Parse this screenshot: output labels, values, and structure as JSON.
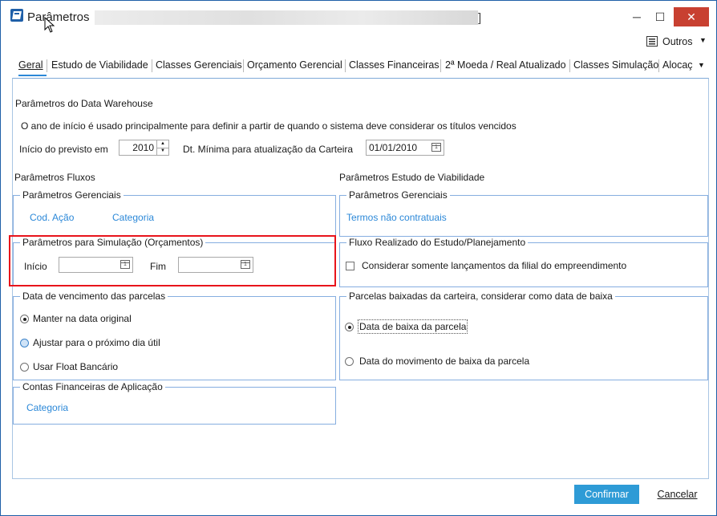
{
  "window": {
    "title": "Parâmetros",
    "title_suffix": "]",
    "minimize_glyph": "─",
    "maximize_glyph": "☐",
    "close_glyph": "✕"
  },
  "toolbar": {
    "outros_label": "Outros"
  },
  "tabs": [
    {
      "label": "Geral"
    },
    {
      "label": "Estudo de Viabilidade"
    },
    {
      "label": "Classes Gerenciais"
    },
    {
      "label": "Orçamento Gerencial"
    },
    {
      "label": "Classes Financeiras"
    },
    {
      "label": "2ª Moeda / Real Atualizado"
    },
    {
      "label": "Classes Simulação"
    },
    {
      "label": "Alocaç"
    }
  ],
  "dw": {
    "title": "Parâmetros do Data Warehouse",
    "desc": "O ano de início é usado principalmente para definir a partir de quando o sistema deve considerar os títulos vencidos",
    "inicio_label": "Início do previsto em",
    "inicio_value": "2010",
    "dt_label": "Dt. Mínima para atualização da Carteira",
    "dt_value": "01/01/2010"
  },
  "fluxos": {
    "title": "Parâmetros Fluxos",
    "gerenciais": {
      "title": "Parâmetros Gerenciais",
      "link1": "Cod. Ação",
      "link2": "Categoria"
    },
    "simulacao": {
      "title": "Parâmetros para Simulação (Orçamentos)",
      "inicio_label": "Início",
      "fim_label": "Fim"
    },
    "vencimento": {
      "title": "Data de vencimento das parcelas",
      "options": [
        "Manter na data original",
        "Ajustar para o próximo dia útil",
        "Usar Float Bancário"
      ]
    },
    "contas": {
      "title": "Contas Financeiras de Aplicação",
      "link": "Categoria"
    }
  },
  "viabilidade": {
    "title": "Parâmetros Estudo de Viabilidade",
    "gerenciais": {
      "title": "Parâmetros Gerenciais",
      "link": "Termos não contratuais"
    },
    "fluxo_realizado": {
      "title": "Fluxo Realizado do Estudo/Planejamento",
      "checkbox_label": "Considerar somente lançamentos da filial do empreendimento"
    },
    "baixadas": {
      "title": "Parcelas baixadas da carteira, considerar como data de baixa",
      "options": [
        "Data de baixa da parcela",
        "Data do movimento de baixa da parcela"
      ]
    }
  },
  "footer": {
    "confirm_label": "Confirmar",
    "cancel_label": "Cancelar"
  },
  "colors": {
    "accent": "#2e9bd6",
    "highlight_border": "#e8141b",
    "close": "#c84031",
    "link": "#2b88d8"
  }
}
